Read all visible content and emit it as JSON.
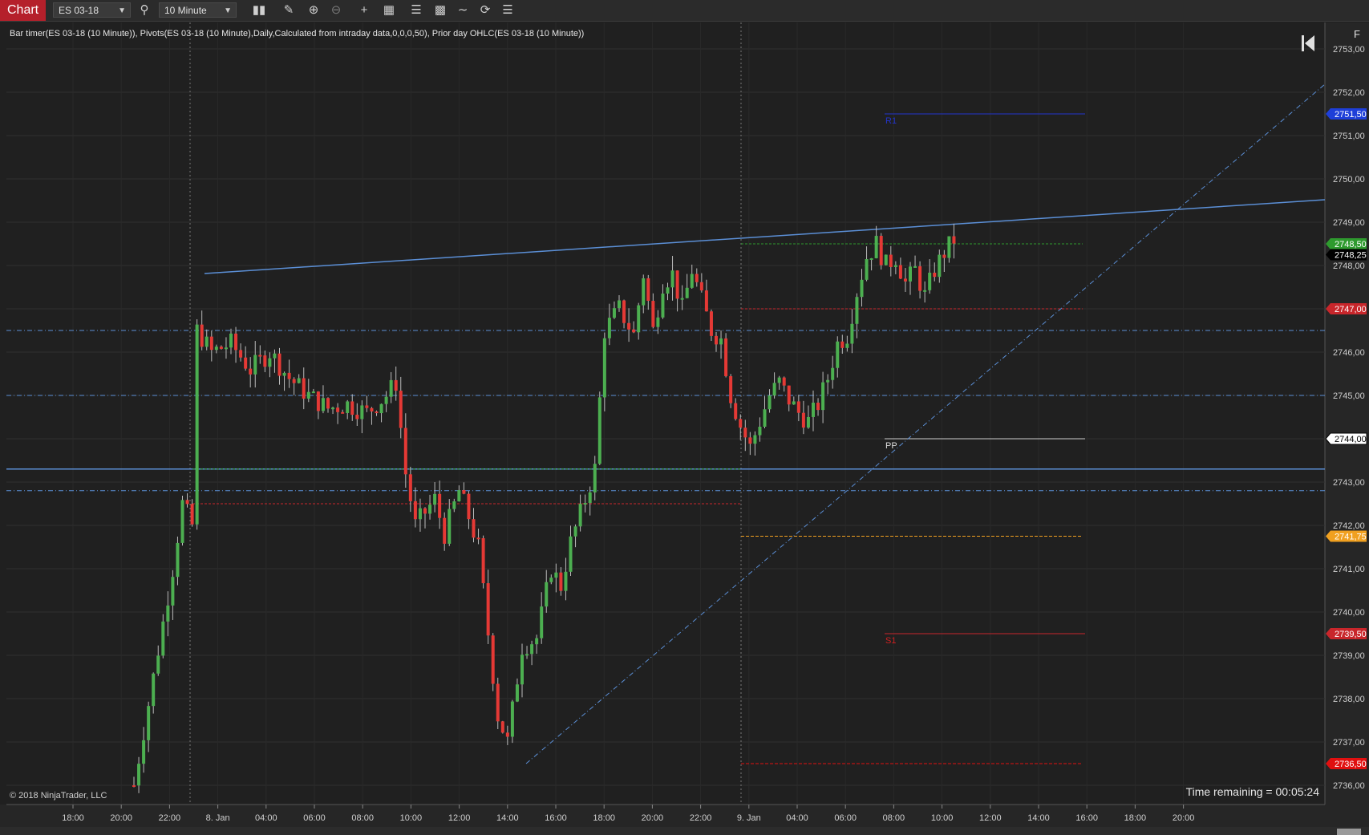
{
  "toolbar": {
    "chart_tab": "Chart",
    "instrument": "ES 03-18",
    "interval": "10 Minute",
    "icons": [
      "search-icon",
      "bar-type-icon",
      "draw-tool-icon",
      "zoom-in-icon",
      "zoom-out-icon",
      "crosshair-icon",
      "templates-icon",
      "data-series-icon",
      "strategies-icon",
      "indicators-icon",
      "refresh-icon",
      "properties-icon"
    ]
  },
  "chart": {
    "indicator_label": "Bar timer(ES 03-18 (10 Minute)), Pivots(ES 03-18 (10 Minute),Daily,Calculated from intraday data,0,0,0,50), Prior day OHLC(ES 03-18 (10 Minute))",
    "copyright": "© 2018 NinjaTrader, LLC",
    "time_remaining": "Time remaining = 00:05:24",
    "f_label": "F",
    "colors": {
      "background": "#202020",
      "up": "#4caf50",
      "down": "#e53935",
      "grid": "#333333",
      "trend": "#5b8fd6"
    }
  },
  "chart_data": {
    "type": "candlestick",
    "instrument": "ES 03-18",
    "interval": "10 Minute",
    "x_ticks": [
      "18:00",
      "20:00",
      "22:00",
      "8. Jan",
      "04:00",
      "06:00",
      "08:00",
      "10:00",
      "12:00",
      "14:00",
      "16:00",
      "18:00",
      "20:00",
      "22:00",
      "9. Jan",
      "04:00",
      "06:00",
      "08:00",
      "10:00",
      "12:00",
      "14:00",
      "16:00",
      "18:00",
      "20:00"
    ],
    "y_ticks": [
      "2753,00",
      "2752,00",
      "2751,00",
      "2750,00",
      "2749,00",
      "2748,00",
      "2747,00",
      "2746,00",
      "2745,00",
      "2744,00",
      "2743,00",
      "2742,00",
      "2741,00",
      "2740,00",
      "2739,00",
      "2738,00",
      "2737,00",
      "2736,00"
    ],
    "ylim": [
      2735.7,
      2753.3
    ],
    "price_markers": [
      {
        "value": 2751.5,
        "label": "2751,50",
        "color": "#1e3fd8"
      },
      {
        "value": 2748.5,
        "label": "2748,50",
        "color": "#2e9a2e"
      },
      {
        "value": 2748.25,
        "label": "2748,25",
        "color": "#000000"
      },
      {
        "value": 2747.0,
        "label": "2747,00",
        "color": "#c8262b"
      },
      {
        "value": 2744.0,
        "label": "2744,00",
        "color": "#ffffff"
      },
      {
        "value": 2741.75,
        "label": "2741,75",
        "color": "#f0a020"
      },
      {
        "value": 2739.5,
        "label": "2739,50",
        "color": "#c8262b"
      },
      {
        "value": 2736.5,
        "label": "2736,50",
        "color": "#e01010"
      }
    ],
    "pivot_labels": [
      {
        "text": "R1",
        "value": 2751.5,
        "color": "#2233cc"
      },
      {
        "text": "PP",
        "value": 2744.0,
        "color": "#dddddd"
      },
      {
        "text": "S1",
        "value": 2739.5,
        "color": "#d02020"
      }
    ],
    "candle_path": [
      [
        0,
        2736.0
      ],
      [
        4,
        2738.5
      ],
      [
        8,
        2741.0
      ],
      [
        10,
        2742.5
      ],
      [
        12,
        2742.0
      ],
      [
        13,
        2746.5
      ],
      [
        16,
        2746.0
      ],
      [
        20,
        2746.2
      ],
      [
        24,
        2745.6
      ],
      [
        28,
        2746.0
      ],
      [
        32,
        2745.4
      ],
      [
        36,
        2745.0
      ],
      [
        40,
        2744.7
      ],
      [
        44,
        2744.8
      ],
      [
        48,
        2744.6
      ],
      [
        52,
        2745.0
      ],
      [
        54,
        2745.3
      ],
      [
        56,
        2743.2
      ],
      [
        58,
        2742.0
      ],
      [
        62,
        2742.6
      ],
      [
        64,
        2741.8
      ],
      [
        67,
        2742.8
      ],
      [
        69,
        2742.2
      ],
      [
        71,
        2741.5
      ],
      [
        73,
        2739.5
      ],
      [
        75,
        2737.6
      ],
      [
        77,
        2737.0
      ],
      [
        80,
        2739.2
      ],
      [
        83,
        2739.4
      ],
      [
        86,
        2741.0
      ],
      [
        88,
        2740.6
      ],
      [
        90,
        2741.6
      ],
      [
        93,
        2742.6
      ],
      [
        95,
        2743.3
      ],
      [
        97,
        2746.5
      ],
      [
        100,
        2747.0
      ],
      [
        103,
        2746.4
      ],
      [
        105,
        2747.8
      ],
      [
        107,
        2746.5
      ],
      [
        109,
        2747.6
      ],
      [
        111,
        2747.8
      ],
      [
        113,
        2747.0
      ],
      [
        115,
        2747.9
      ],
      [
        117,
        2747.2
      ],
      [
        119,
        2746.5
      ],
      [
        121,
        2746.3
      ],
      [
        123,
        2745.0
      ],
      [
        125,
        2744.3
      ],
      [
        127,
        2743.8
      ],
      [
        129,
        2744.4
      ],
      [
        131,
        2745.0
      ],
      [
        133,
        2745.3
      ],
      [
        135,
        2744.9
      ],
      [
        137,
        2744.6
      ],
      [
        139,
        2744.4
      ],
      [
        141,
        2744.8
      ],
      [
        143,
        2745.4
      ],
      [
        145,
        2746.2
      ],
      [
        147,
        2746.4
      ],
      [
        149,
        2747.4
      ],
      [
        151,
        2748.2
      ],
      [
        153,
        2748.5
      ],
      [
        155,
        2748.0
      ],
      [
        157,
        2748.2
      ],
      [
        159,
        2747.6
      ],
      [
        161,
        2747.9
      ],
      [
        163,
        2747.3
      ],
      [
        165,
        2747.9
      ],
      [
        167,
        2748.3
      ],
      [
        169,
        2748.6
      ],
      [
        170,
        2748.3
      ]
    ]
  }
}
